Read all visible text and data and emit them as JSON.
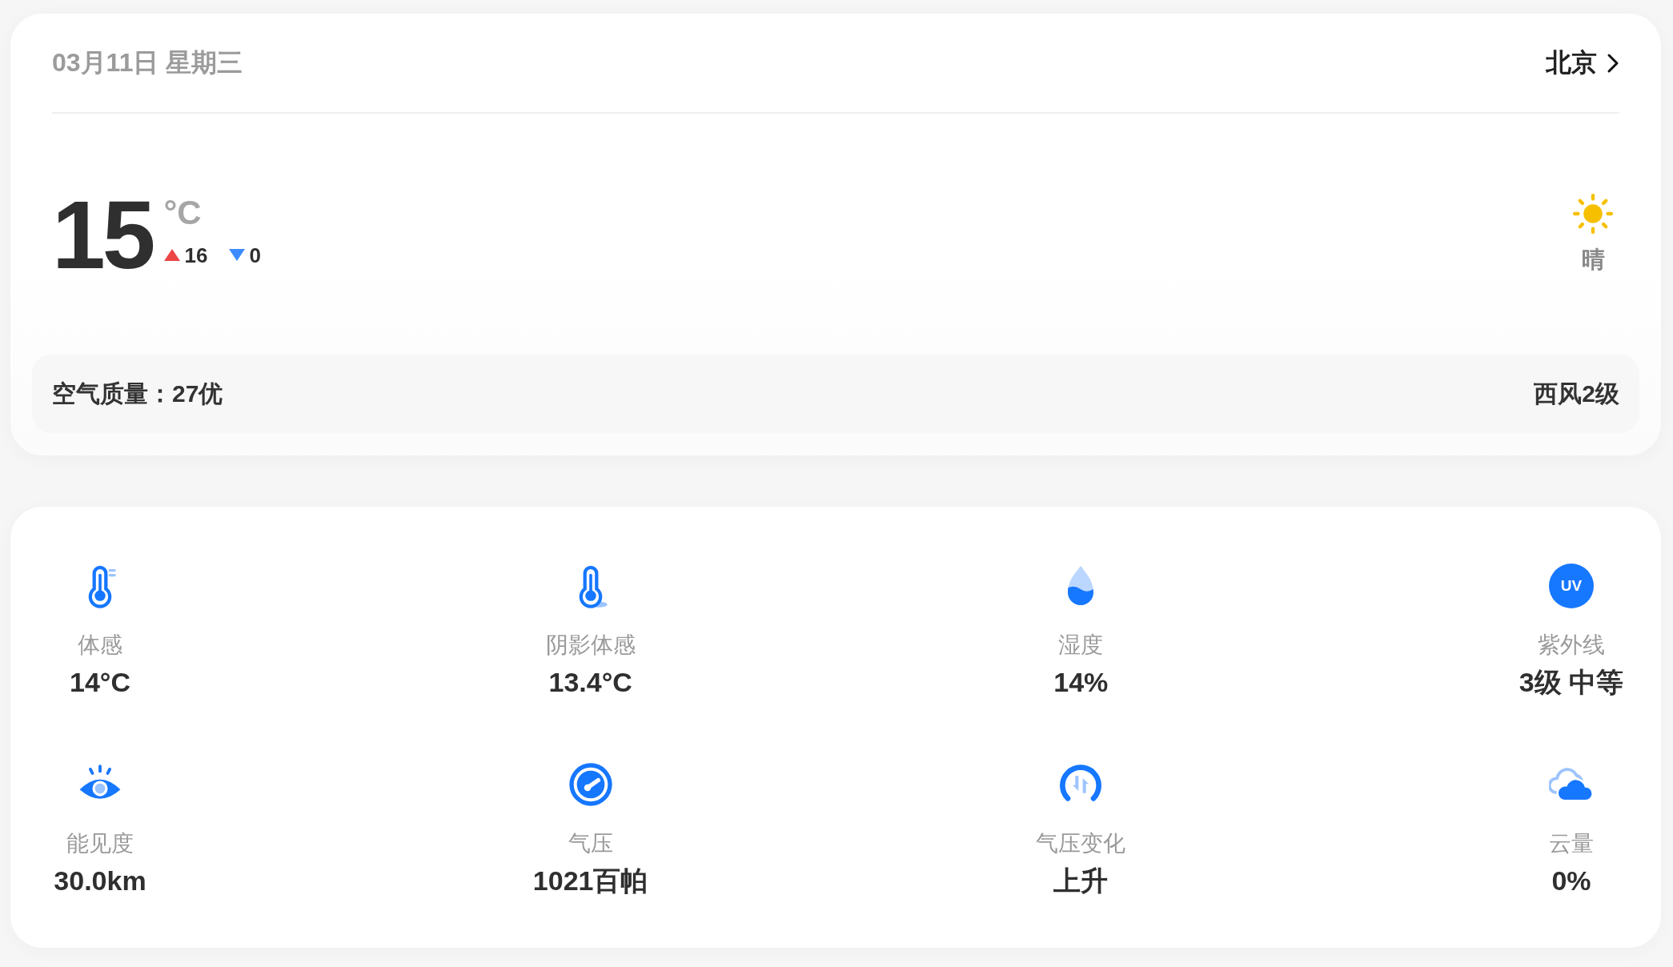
{
  "header": {
    "date": "03月11日 星期三",
    "city": "北京"
  },
  "current": {
    "temperature": "15",
    "unit": "°C",
    "high": "16",
    "low": "0",
    "condition": {
      "kind": "sunny",
      "label": "晴"
    }
  },
  "air": {
    "quality": "空气质量：27优",
    "wind": "西风2级"
  },
  "metrics": [
    {
      "kind": "feels_like",
      "label": "体感",
      "value": "14°C"
    },
    {
      "kind": "shade",
      "label": "阴影体感",
      "value": "13.4°C"
    },
    {
      "kind": "humidity",
      "label": "湿度",
      "value": "14%"
    },
    {
      "kind": "uv",
      "icon_text": "UV",
      "label": "紫外线",
      "value": "3级 中等"
    },
    {
      "kind": "visibility",
      "label": "能见度",
      "value": "30.0km"
    },
    {
      "kind": "pressure",
      "label": "气压",
      "value": "1021百帕"
    },
    {
      "kind": "pressure_trend",
      "label": "气压变化",
      "value": "上升"
    },
    {
      "kind": "cloud",
      "label": "云量",
      "value": "0%"
    }
  ]
}
